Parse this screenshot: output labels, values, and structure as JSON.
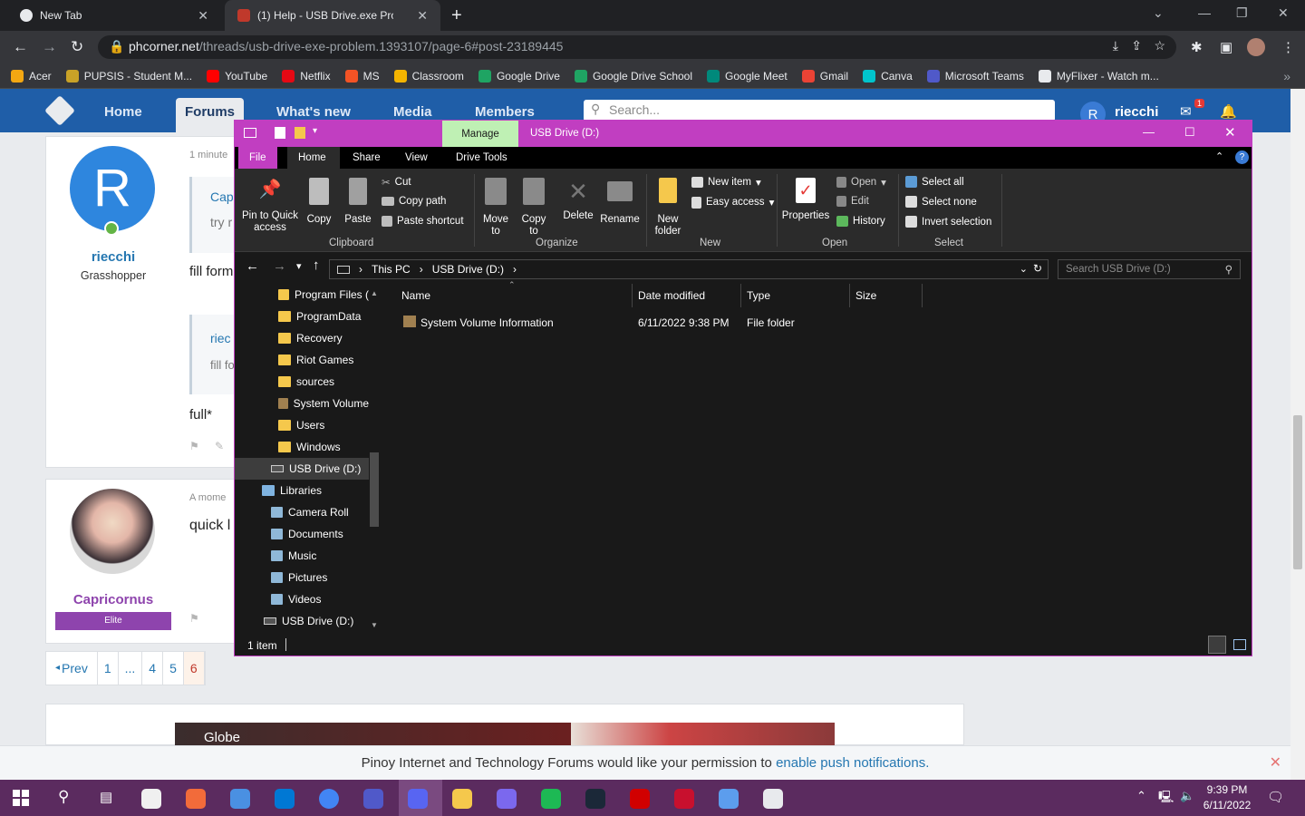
{
  "browser": {
    "tabs": [
      {
        "title": "New Tab"
      },
      {
        "title": "(1) Help - USB Drive.exe Problem"
      }
    ],
    "url_host": "phcorner.net",
    "url_path": "/threads/usb-drive-exe-problem.1393107/page-6#post-23189445",
    "bookmarks": [
      {
        "label": "Acer",
        "color": "#f3a712"
      },
      {
        "label": "PUPSIS - Student M...",
        "color": "#c9a227"
      },
      {
        "label": "YouTube",
        "color": "#ff0000"
      },
      {
        "label": "Netflix",
        "color": "#e50914"
      },
      {
        "label": "MS",
        "color": "#f35325"
      },
      {
        "label": "Classroom",
        "color": "#f4b400"
      },
      {
        "label": "Google Drive",
        "color": "#1fa463"
      },
      {
        "label": "Google Drive School",
        "color": "#1fa463"
      },
      {
        "label": "Google Meet",
        "color": "#00897b"
      },
      {
        "label": "Gmail",
        "color": "#ea4335"
      },
      {
        "label": "Canva",
        "color": "#00c4cc"
      },
      {
        "label": "Microsoft Teams",
        "color": "#5059c9"
      },
      {
        "label": "MyFlixer - Watch m...",
        "color": "#e8eaed"
      }
    ]
  },
  "forum": {
    "nav": [
      "Home",
      "Forums",
      "What's new",
      "Media",
      "Members"
    ],
    "search_placeholder": "Search...",
    "username": "riecchi",
    "avatar_letter": "R",
    "alert_count": "1",
    "post1": {
      "time": "1 minute",
      "quote_title": "Cap",
      "quote_text": "try r",
      "body": "fill form",
      "user": "riecchi",
      "title": "Grasshopper",
      "quote2_user": "riec",
      "quote2_text": "fill fo",
      "body2": "full*"
    },
    "post2": {
      "time": "A mome",
      "body": "quick l",
      "user": "Capricornus",
      "badge": "Elite"
    },
    "pagination": [
      "Prev",
      "1",
      "...",
      "4",
      "5",
      "6"
    ],
    "notification": "Pinoy Internet and Technology Forums would like your permission to",
    "notification_link": "enable push notifications.",
    "ad_text": "Globe"
  },
  "explorer": {
    "manage": "Manage",
    "title": "USB Drive (D:)",
    "tabs": [
      "File",
      "Home",
      "Share",
      "View",
      "Drive Tools"
    ],
    "clipboard": {
      "pin": "Pin to Quick access",
      "copy": "Copy",
      "paste": "Paste",
      "cut": "Cut",
      "copy_path": "Copy path",
      "paste_shortcut": "Paste shortcut",
      "label": "Clipboard"
    },
    "organize": {
      "move": "Move to",
      "copy_to": "Copy to",
      "delete": "Delete",
      "rename": "Rename",
      "label": "Organize"
    },
    "new": {
      "folder": "New folder",
      "item": "New item",
      "easy": "Easy access",
      "label": "New"
    },
    "open": {
      "properties": "Properties",
      "open": "Open",
      "edit": "Edit",
      "history": "History",
      "label": "Open"
    },
    "select": {
      "all": "Select all",
      "none": "Select none",
      "invert": "Invert selection",
      "label": "Select"
    },
    "breadcrumb": [
      "This PC",
      "USB Drive (D:)"
    ],
    "search_placeholder": "Search USB Drive (D:)",
    "nav_items": [
      {
        "label": "Program Files (",
        "type": "folder"
      },
      {
        "label": "ProgramData",
        "type": "folder"
      },
      {
        "label": "Recovery",
        "type": "folder"
      },
      {
        "label": "Riot Games",
        "type": "folder"
      },
      {
        "label": "sources",
        "type": "folder"
      },
      {
        "label": "System Volume",
        "type": "folder"
      },
      {
        "label": "Users",
        "type": "folder"
      },
      {
        "label": "Windows",
        "type": "folder"
      },
      {
        "label": "USB Drive (D:)",
        "type": "drive"
      },
      {
        "label": "Libraries",
        "type": "library"
      },
      {
        "label": "Camera Roll",
        "type": "lib"
      },
      {
        "label": "Documents",
        "type": "lib"
      },
      {
        "label": "Music",
        "type": "lib"
      },
      {
        "label": "Pictures",
        "type": "lib"
      },
      {
        "label": "Videos",
        "type": "lib"
      },
      {
        "label": "USB Drive (D:)",
        "type": "drive"
      }
    ],
    "columns": [
      "Name",
      "Date modified",
      "Type",
      "Size"
    ],
    "files": [
      {
        "name": "System Volume Information",
        "date": "6/11/2022 9:38 PM",
        "type": "File folder",
        "size": ""
      }
    ],
    "status": "1 item"
  },
  "taskbar": {
    "time": "9:39 PM",
    "date": "6/11/2022",
    "apps": [
      "#f0f0f0",
      "#f26b3a",
      "#4a90e2",
      "#0078d4",
      "#4285f4",
      "#5059c9",
      "#5865f2",
      "#f5c84c",
      "#7b68ee",
      "#1db954",
      "#1b2838",
      "#d10000",
      "#c8102e",
      "#5c9ded",
      "#e8eaed"
    ]
  }
}
